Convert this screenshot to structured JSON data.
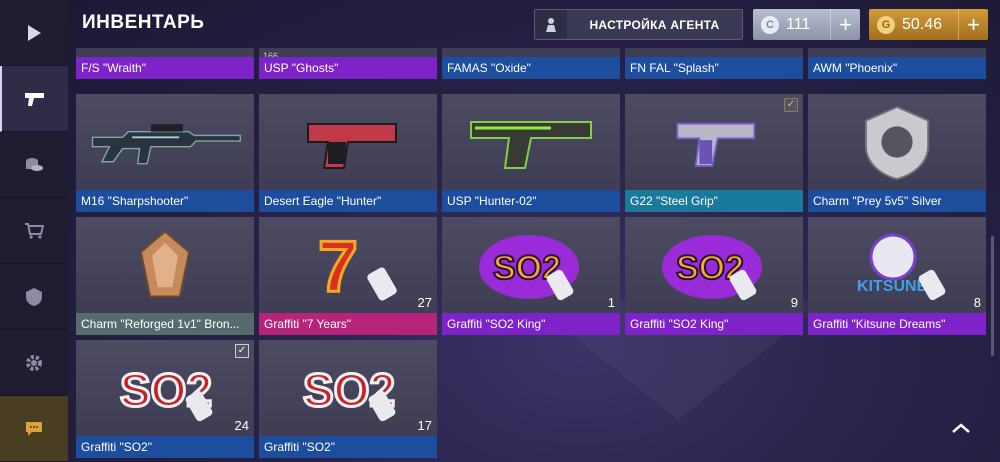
{
  "header": {
    "title": "ИНВЕНТАРЬ",
    "agent_label": "НАСТРОЙКА АГЕНТА",
    "silver_amount": "111",
    "gold_amount": "50.46"
  },
  "sidebar": {
    "items": [
      {
        "name": "play",
        "icon": "play-icon"
      },
      {
        "name": "inventory",
        "icon": "pistol-icon",
        "active": true
      },
      {
        "name": "coins",
        "icon": "coins-icon"
      },
      {
        "name": "shop",
        "icon": "cart-icon"
      },
      {
        "name": "clan",
        "icon": "shield-icon"
      },
      {
        "name": "settings",
        "icon": "gear-icon"
      },
      {
        "name": "chat",
        "icon": "chat-icon"
      }
    ]
  },
  "items": [
    {
      "name": "F/S \"Wraith\"",
      "rarity": "purple",
      "kind": "partial"
    },
    {
      "name": "USP \"Ghosts\"",
      "rarity": "purple",
      "kind": "partial",
      "tag": "166"
    },
    {
      "name": "FAMAS \"Oxide\"",
      "rarity": "blue",
      "kind": "partial"
    },
    {
      "name": "FN FAL \"Splash\"",
      "rarity": "blue",
      "kind": "partial"
    },
    {
      "name": "AWM \"Phoenix\"",
      "rarity": "blue",
      "kind": "partial"
    },
    {
      "name": "M16 \"Sharpshooter\"",
      "rarity": "blue",
      "kind": "rifle"
    },
    {
      "name": "Desert Eagle \"Hunter\"",
      "rarity": "blue",
      "kind": "deagle"
    },
    {
      "name": "USP \"Hunter-02\"",
      "rarity": "blue",
      "kind": "usp"
    },
    {
      "name": "G22 \"Steel Grip\"",
      "rarity": "teal",
      "kind": "glock",
      "checked": "gold"
    },
    {
      "name": "Charm \"Prey 5v5\" Silver",
      "rarity": "blue",
      "kind": "charm-silver"
    },
    {
      "name": "Charm \"Reforged 1v1\" Bron...",
      "rarity": "gray",
      "kind": "charm-bronze"
    },
    {
      "name": "Graffiti \"7 Years\"",
      "rarity": "pink",
      "kind": "graffiti-7",
      "count": "27"
    },
    {
      "name": "Graffiti \"SO2 King\"",
      "rarity": "purple",
      "kind": "graffiti-king",
      "count": "1"
    },
    {
      "name": "Graffiti \"SO2 King\"",
      "rarity": "purple",
      "kind": "graffiti-king",
      "count": "9"
    },
    {
      "name": "Graffiti \"Kitsune Dreams\"",
      "rarity": "purple",
      "kind": "graffiti-kitsune",
      "count": "8"
    },
    {
      "name": "Graffiti \"SO2\"",
      "rarity": "blue",
      "kind": "graffiti-so2",
      "count": "24",
      "checked": "white"
    },
    {
      "name": "Graffiti \"SO2\"",
      "rarity": "blue",
      "kind": "graffiti-so2",
      "count": "17"
    }
  ],
  "art_text": {
    "so2": "SO2",
    "seven": "7",
    "kitsune": "KITSUNE"
  },
  "colors": {
    "purple": "#7e23c9",
    "blue": "#1d4e9e",
    "teal": "#197a9c",
    "gray": "#566b6e",
    "pink": "#b5247b",
    "gold": "#c08a2e"
  }
}
